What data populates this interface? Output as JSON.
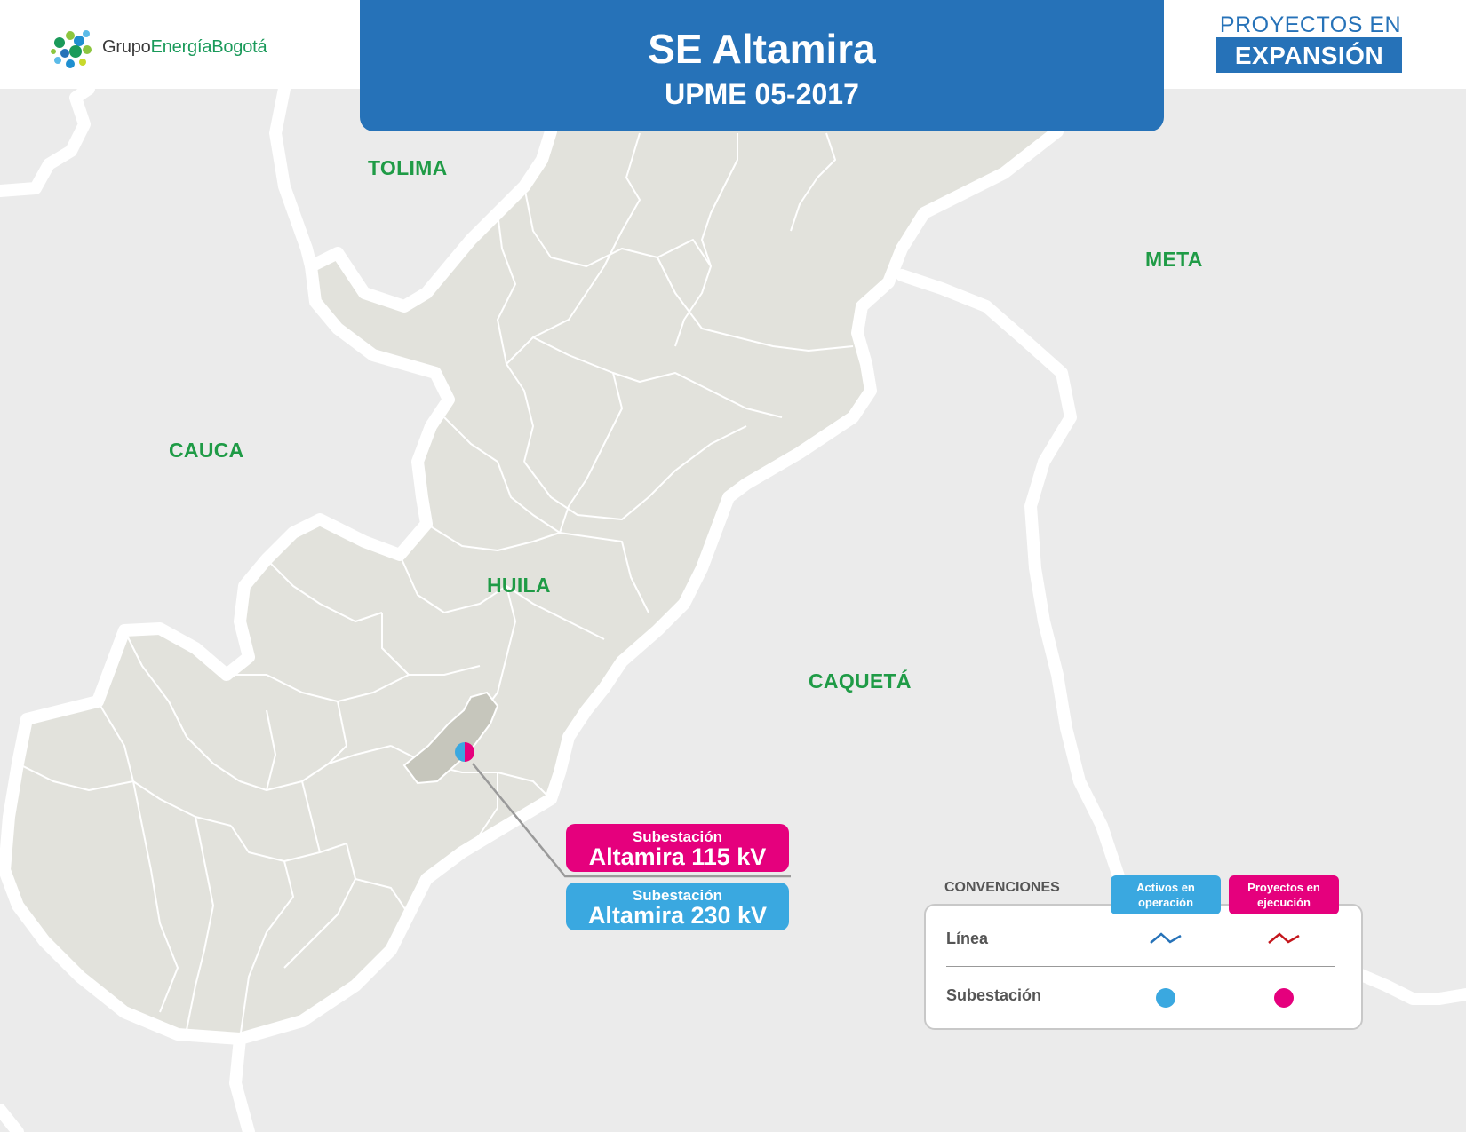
{
  "header": {
    "logo_text_part1": "Grupo",
    "logo_text_part2": "EnergíaBogotá",
    "title": "SE Altamira",
    "subtitle": "UPME 05-2017",
    "badge_top": "PROYECTOS EN",
    "badge_bottom": "EXPANSIÓN"
  },
  "regions": {
    "tolima": "TOLIMA",
    "meta": "META",
    "cauca": "CAUCA",
    "huila": "HUILA",
    "caqueta": "CAQUETÁ"
  },
  "callouts": {
    "project": {
      "line1": "Subestación",
      "line2": "Altamira 115 kV"
    },
    "existing": {
      "line1": "Subestación",
      "line2": "Altamira 230 kV"
    }
  },
  "legend": {
    "title": "CONVENCIONES",
    "col_operation": "Activos en operación",
    "col_execution": "Proyectos en ejecución",
    "row_line": "Línea",
    "row_substation": "Subestación"
  },
  "colors": {
    "title_blue": "#2672b8",
    "operation_blue": "#3aa8e0",
    "execution_magenta": "#e5007d",
    "region_green": "#1f9b46",
    "huila_fill": "#e2e2dc",
    "altamira_fill": "#c6c6bc"
  }
}
